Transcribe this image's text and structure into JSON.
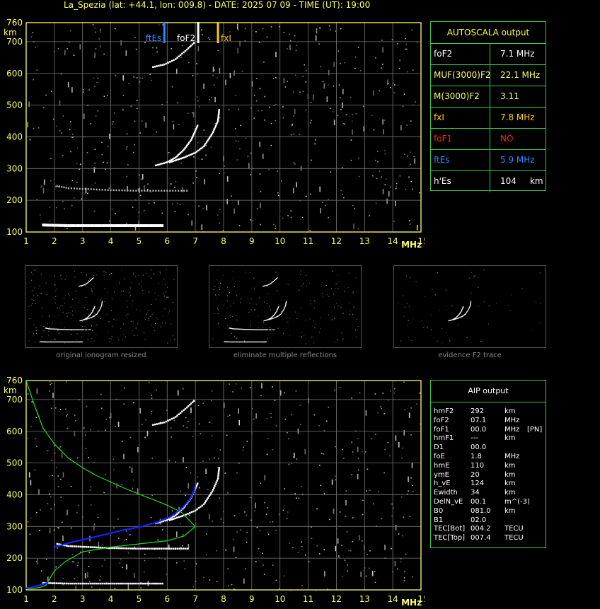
{
  "header": {
    "title": "La_Spezia (lat: +44.1, lon: 009.8) - DATE: 2025 07 09 - TIME (UT): 19:00"
  },
  "colors": {
    "axis": "#ffff66",
    "grid": "#777777",
    "panel_border": "#33cc55",
    "foF2": "#ffffff",
    "fxI": "#ffcc00",
    "ftEs": "#3388ff",
    "foF1": "#ff2222",
    "profile_green": "#22dd22",
    "profile_blue": "#1122ff",
    "caption": "#888888"
  },
  "chart_data": [
    {
      "type": "scatter",
      "name_ref": "main-ionogram",
      "xlabel": "MHz",
      "ylabel": "km",
      "xlim": [
        1,
        15
      ],
      "ylim": [
        100,
        760
      ],
      "xticks": [
        "1",
        "2",
        "3",
        "4",
        "5",
        "6",
        "7",
        "8",
        "9",
        "10",
        "11",
        "12",
        "13",
        "14",
        "15"
      ],
      "yticks": [
        "100",
        "200",
        "300",
        "400",
        "500",
        "600",
        "700",
        "760"
      ],
      "grid": true,
      "markers": [
        {
          "label": "ftEs",
          "x": 5.9,
          "color": "#3388ff"
        },
        {
          "label": "foF2",
          "x": 7.1,
          "color": "#ffffff"
        },
        {
          "label": "fxI",
          "x": 7.8,
          "color": "#ffcc00"
        }
      ],
      "traces": [
        {
          "kind": "Es",
          "points": [
            [
              1.6,
              122
            ],
            [
              2,
              121
            ],
            [
              2.5,
              120
            ],
            [
              3,
              120
            ],
            [
              3.5,
              120
            ],
            [
              4,
              120
            ],
            [
              4.5,
              120
            ],
            [
              5,
              120
            ],
            [
              5.5,
              120
            ],
            [
              5.9,
              120
            ]
          ]
        },
        {
          "kind": "Es2",
          "points": [
            [
              2.1,
              245
            ],
            [
              2.5,
              238
            ],
            [
              3,
              236
            ],
            [
              3.5,
              234
            ],
            [
              4,
              232
            ],
            [
              4.5,
              231
            ],
            [
              5,
              230
            ],
            [
              5.5,
              230
            ],
            [
              6,
              230
            ],
            [
              6.8,
              230
            ]
          ]
        },
        {
          "kind": "F2o",
          "points": [
            [
              5.6,
              310
            ],
            [
              6,
              320
            ],
            [
              6.3,
              335
            ],
            [
              6.6,
              360
            ],
            [
              6.85,
              390
            ],
            [
              7.0,
              420
            ],
            [
              7.1,
              440
            ]
          ]
        },
        {
          "kind": "F2x",
          "points": [
            [
              6.1,
              320
            ],
            [
              6.6,
              335
            ],
            [
              7.0,
              350
            ],
            [
              7.3,
              370
            ],
            [
              7.6,
              410
            ],
            [
              7.8,
              450
            ],
            [
              7.85,
              490
            ]
          ]
        },
        {
          "kind": "F2multi",
          "points": [
            [
              5.5,
              620
            ],
            [
              5.9,
              628
            ],
            [
              6.3,
              645
            ],
            [
              6.7,
              675
            ],
            [
              7.0,
              700
            ]
          ]
        }
      ]
    },
    {
      "type": "line",
      "name_ref": "aip-profile",
      "xlabel": "MHz",
      "ylabel": "km",
      "xlim": [
        1,
        15
      ],
      "ylim": [
        100,
        760
      ],
      "xticks": [
        "1",
        "2",
        "3",
        "4",
        "5",
        "6",
        "7",
        "8",
        "9",
        "10",
        "11",
        "12",
        "13",
        "14",
        "15"
      ],
      "yticks": [
        "100",
        "200",
        "300",
        "400",
        "500",
        "600",
        "700",
        "760"
      ],
      "grid": true,
      "series": [
        {
          "kind": "profile-green",
          "points": [
            [
              1.0,
              760
            ],
            [
              1.3,
              680
            ],
            [
              1.6,
              610
            ],
            [
              2.0,
              560
            ],
            [
              2.5,
              515
            ],
            [
              3,
              485
            ],
            [
              3.5,
              460
            ],
            [
              4,
              440
            ],
            [
              4.5,
              420
            ],
            [
              5,
              402
            ],
            [
              5.5,
              385
            ],
            [
              6,
              367
            ],
            [
              6.5,
              345
            ],
            [
              7.0,
              300
            ],
            [
              6.6,
              270
            ],
            [
              6,
              255
            ],
            [
              5,
              245
            ],
            [
              4,
              235
            ],
            [
              3,
              220
            ],
            [
              2.4,
              190
            ],
            [
              2.0,
              160
            ],
            [
              1.8,
              130
            ],
            [
              1.7,
              115
            ],
            [
              1.5,
              108
            ],
            [
              1.2,
              104
            ],
            [
              1.0,
              103
            ]
          ]
        },
        {
          "kind": "profile-blue",
          "points": [
            [
              2.0,
              235
            ],
            [
              2.6,
              250
            ],
            [
              3.2,
              262
            ],
            [
              3.8,
              275
            ],
            [
              4.4,
              288
            ],
            [
              5.0,
              298
            ],
            [
              5.6,
              312
            ],
            [
              6.1,
              330
            ],
            [
              6.5,
              355
            ],
            [
              6.8,
              385
            ],
            [
              6.95,
              410
            ],
            [
              7.0,
              430
            ]
          ]
        },
        {
          "kind": "profile-low-blue",
          "points": [
            [
              1.0,
              105
            ],
            [
              1.3,
              110
            ],
            [
              1.6,
              118
            ],
            [
              1.8,
              124
            ]
          ]
        }
      ]
    }
  ],
  "autoscala": {
    "title": "AUTOSCALA output",
    "rows": [
      {
        "key": "foF2",
        "value": "7.1 MHz",
        "key_color": "#ffffff",
        "value_color": "#ffffff"
      },
      {
        "key": "MUF(3000)F2",
        "value": "22.1 MHz",
        "key_color": "#ffff66",
        "value_color": "#ffff66"
      },
      {
        "key": "M(3000)F2",
        "value": "3.11",
        "key_color": "#ffff66",
        "value_color": "#ffff66"
      },
      {
        "key": "fxI",
        "value": "7.8 MHz",
        "key_color": "#ffcc00",
        "value_color": "#ffcc00"
      },
      {
        "key": "foF1",
        "value": "NO",
        "key_color": "#ff2222",
        "value_color": "#ff2222"
      },
      {
        "key": "ftEs",
        "value": "5.9 MHz",
        "key_color": "#3388ff",
        "value_color": "#3388ff"
      },
      {
        "key": "h'Es",
        "value": "104     km",
        "key_color": "#ffffff",
        "value_color": "#ffffff"
      }
    ]
  },
  "aip": {
    "title": "AIP output",
    "rows": [
      [
        "hmF2",
        "292",
        "km",
        ""
      ],
      [
        "foF2",
        "07.1",
        "MHz",
        ""
      ],
      [
        "foF1",
        "00.0",
        "MHz",
        "[PN]"
      ],
      [
        "hmF1",
        "---",
        "km",
        ""
      ],
      [
        "D1",
        "00.0",
        "",
        ""
      ],
      [
        "foE",
        "1.8",
        "MHz",
        ""
      ],
      [
        "hmE",
        "110",
        "km",
        ""
      ],
      [
        "ymE",
        "20",
        "km",
        ""
      ],
      [
        "h_vE",
        "124",
        "km",
        ""
      ],
      [
        "Ewidth",
        "34",
        "km",
        ""
      ],
      [
        "DelN_vE",
        "00.1",
        "m^(-3)",
        ""
      ],
      [
        "B0",
        "081.0",
        "km",
        ""
      ],
      [
        "B1",
        "02.0",
        "",
        ""
      ],
      [
        "TEC[Bot]",
        "004.2",
        "TECU",
        ""
      ],
      [
        "TEC[Top]",
        "007.4",
        "TECU",
        ""
      ]
    ]
  },
  "thumbnails": [
    {
      "caption": "original ionogram resized"
    },
    {
      "caption": "eliminate multiple reflections"
    },
    {
      "caption": "evidence F2 trace"
    }
  ]
}
